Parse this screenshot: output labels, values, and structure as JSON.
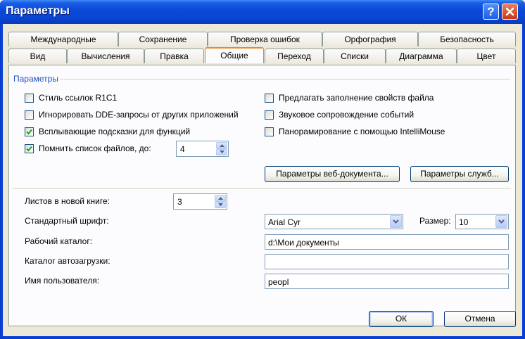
{
  "window": {
    "title": "Параметры",
    "help_label": "?"
  },
  "tabs_row1": [
    "Международные",
    "Сохранение",
    "Проверка ошибок",
    "Орфография",
    "Безопасность"
  ],
  "tabs_row2": [
    "Вид",
    "Вычисления",
    "Правка",
    "Общие",
    "Переход",
    "Списки",
    "Диаграмма",
    "Цвет"
  ],
  "active_tab": "Общие",
  "settings": {
    "section_title": "Параметры",
    "checkboxes": [
      {
        "label": "Стиль ссылок R1C1",
        "checked": false
      },
      {
        "label": "Игнорировать DDE-запросы от других приложений",
        "checked": false
      },
      {
        "label": "Всплывающие подсказки для функций",
        "checked": true
      },
      {
        "label": "Помнить список файлов, до:",
        "checked": true
      },
      {
        "label": "Предлагать заполнение свойств файла",
        "checked": false
      },
      {
        "label": "Звуковое сопровождение событий",
        "checked": false
      },
      {
        "label": "Панорамирование с помощью IntelliMouse",
        "checked": false
      }
    ],
    "recent_files_count": "4",
    "web_options_button": "Параметры веб-документа...",
    "services_options_button": "Параметры служб..."
  },
  "workbook": {
    "sheets_label": "Листов в новой книге:",
    "sheets_value": "3",
    "font_label": "Стандартный шрифт:",
    "font_value": "Arial Cyr",
    "size_label": "Размер:",
    "size_value": "10",
    "default_dir_label": "Рабочий каталог:",
    "default_dir_value": "d:\\Мои документы",
    "startup_dir_label": "Каталог автозагрузки:",
    "startup_dir_value": "",
    "username_label": "Имя пользователя:",
    "username_value": "peopl"
  },
  "footer": {
    "ok_label": "ОК",
    "cancel_label": "Отмена"
  },
  "colors": {
    "title_bar": "#0a4ad8",
    "dialog_bg": "#ece9d8",
    "section_title": "#1d51c5",
    "active_tab_accent": "#e68b2c",
    "close_button": "#c6391b"
  }
}
